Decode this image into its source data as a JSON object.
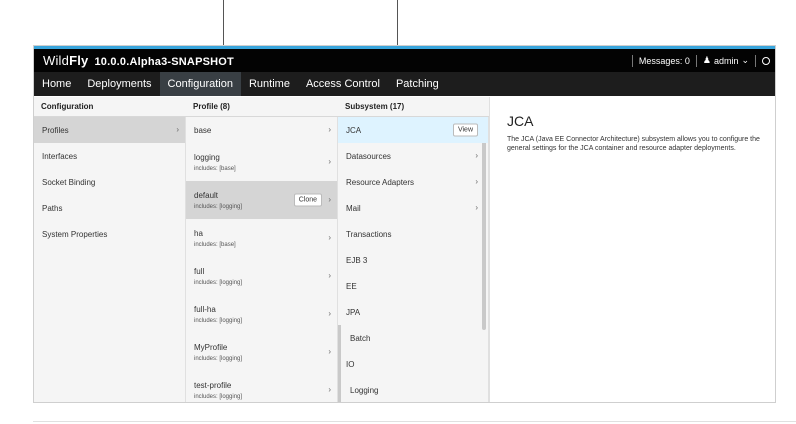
{
  "header": {
    "brand_light": "Wild",
    "brand_bold": "Fly",
    "version": "10.0.0.Alpha3-SNAPSHOT",
    "messages": "Messages: 0",
    "user": "admin"
  },
  "nav": [
    "Home",
    "Deployments",
    "Configuration",
    "Runtime",
    "Access Control",
    "Patching"
  ],
  "columns": {
    "config_title": "Configuration",
    "profile_title": "Profile (8)",
    "subsystem_title": "Subsystem (17)"
  },
  "config_items": [
    "Profiles",
    "Interfaces",
    "Socket Binding",
    "Paths",
    "System Properties"
  ],
  "profiles": [
    {
      "name": "base",
      "includes": ""
    },
    {
      "name": "logging",
      "includes": "includes: [base]"
    },
    {
      "name": "default",
      "includes": "includes: [logging]"
    },
    {
      "name": "ha",
      "includes": "includes: [base]"
    },
    {
      "name": "full",
      "includes": "includes: [logging]"
    },
    {
      "name": "full-ha",
      "includes": "includes: [logging]"
    },
    {
      "name": "MyProfile",
      "includes": "includes: [logging]"
    },
    {
      "name": "test-profile",
      "includes": "includes: [logging]"
    }
  ],
  "clone_label": "Clone",
  "subsystems": [
    "JCA",
    "Datasources",
    "Resource Adapters",
    "Mail",
    "Transactions",
    "EJB 3",
    "EE",
    "JPA",
    "Batch",
    "IO",
    "Logging"
  ],
  "view_label": "View",
  "preview": {
    "title": "JCA",
    "description": "The JCA (Java EE Connector Architecture) subsystem allows you to configure the general settings for the JCA container and resource adapter deployments."
  }
}
